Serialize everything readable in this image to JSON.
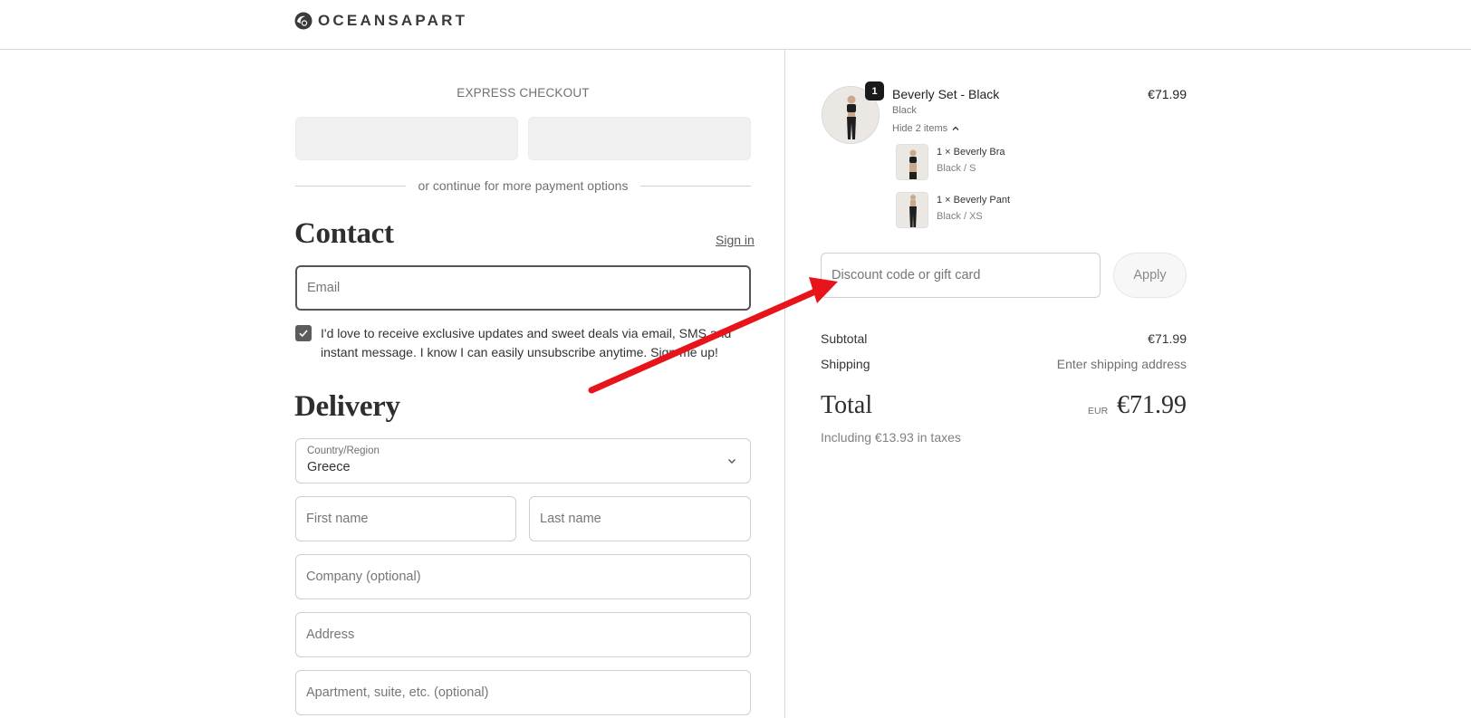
{
  "brand": {
    "name": "OCEANSAPART",
    "logo_icon": "oceansapart-logo-icon"
  },
  "express": {
    "title": "EXPRESS CHECKOUT",
    "divider_text": "or continue for more payment options"
  },
  "contact": {
    "heading": "Contact",
    "signin_label": "Sign in",
    "email_placeholder": "Email",
    "consent_text": "I'd love to receive exclusive updates and sweet deals via email, SMS and instant message. I know I can easily unsubscribe anytime. Sign me up!",
    "consent_checked": true
  },
  "delivery": {
    "heading": "Delivery",
    "country_label": "Country/Region",
    "country_value": "Greece",
    "first_name_placeholder": "First name",
    "last_name_placeholder": "Last name",
    "company_placeholder": "Company (optional)",
    "address_placeholder": "Address",
    "apartment_placeholder": "Apartment, suite, etc. (optional)"
  },
  "order": {
    "quantity": "1",
    "title": "Beverly Set - Black",
    "variant": "Black",
    "price": "€71.99",
    "toggle_label": "Hide 2 items",
    "sub_items": [
      {
        "name": "1 × Beverly Bra",
        "variant": "Black / S"
      },
      {
        "name": "1 × Beverly Pant",
        "variant": "Black / XS"
      }
    ]
  },
  "discount": {
    "placeholder": "Discount code or gift card",
    "apply_label": "Apply"
  },
  "summary": {
    "subtotal_label": "Subtotal",
    "subtotal_value": "€71.99",
    "shipping_label": "Shipping",
    "shipping_value": "Enter shipping address",
    "total_label": "Total",
    "total_currency": "EUR",
    "total_value": "€71.99",
    "taxes_text": "Including €13.93 in taxes"
  },
  "colors": {
    "annotation_arrow": "#e8141b",
    "badge": "#1a1a1a",
    "checkbox": "#5c5c5c"
  }
}
